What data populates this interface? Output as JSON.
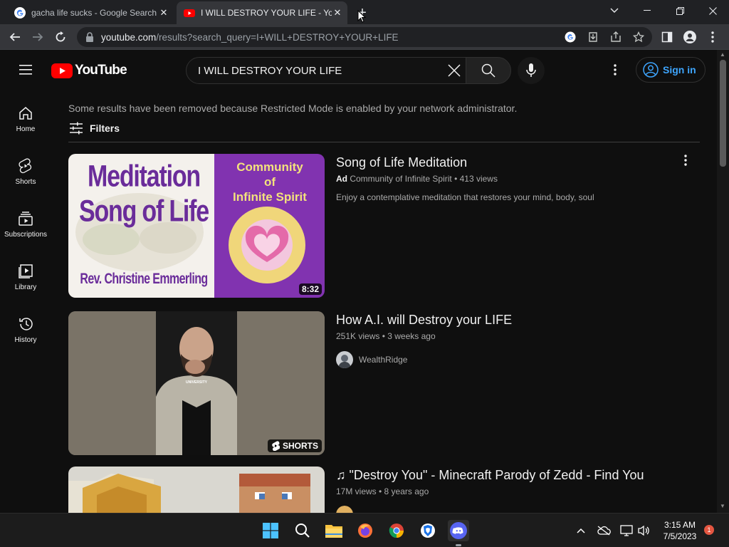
{
  "browser": {
    "tabs": [
      {
        "title": "gacha life sucks - Google Search",
        "favicon": "google-icon",
        "active": false
      },
      {
        "title": "I WILL DESTROY YOUR LIFE - YouTube",
        "favicon": "youtube-icon",
        "active": true
      }
    ],
    "new_tab": "+",
    "url_host": "youtube.com",
    "url_path": "/results?search_query=I+WILL+DESTROY+YOUR+LIFE"
  },
  "youtube": {
    "logo_text": "YouTube",
    "search_query": "I WILL DESTROY YOUR LIFE",
    "sign_in": "Sign in",
    "guide": [
      {
        "label": "Home",
        "icon": "home-icon"
      },
      {
        "label": "Shorts",
        "icon": "shorts-icon"
      },
      {
        "label": "Subscriptions",
        "icon": "subscriptions-icon"
      },
      {
        "label": "Library",
        "icon": "library-icon"
      },
      {
        "label": "History",
        "icon": "history-icon"
      }
    ],
    "notice": "Some results have been removed because Restricted Mode is enabled by your network administrator.",
    "filters_label": "Filters",
    "results": [
      {
        "title": "Song of Life Meditation",
        "ad_label": "Ad",
        "meta": "Community of Infinite Spirit • 413 views",
        "description": "Enjoy a contemplative meditation that restores your mind, body, soul",
        "duration": "8:32",
        "thumb_text": {
          "line1": "Meditation",
          "line2": "Song of Life",
          "line3": "Rev. Christine Emmerling",
          "right1": "Community",
          "right2": "of",
          "right3": "Infinite Spirit"
        }
      },
      {
        "title": "How A.I. will Destroy your LIFE",
        "meta": "251K views • 3 weeks ago",
        "channel": "WealthRidge",
        "badge": "SHORTS",
        "thumb_caption": "UNIVERSITY"
      },
      {
        "title": "♫ \"Destroy You\" - Minecraft Parody of Zedd - Find You",
        "meta": "17M views • 8 years ago"
      }
    ]
  },
  "taskbar": {
    "clock_time": "3:15 AM",
    "clock_date": "7/5/2023",
    "notification_count": "1"
  },
  "colors": {
    "yt_red": "#ff0000",
    "link_blue": "#3ea6ff",
    "background": "#0f0f0f"
  }
}
